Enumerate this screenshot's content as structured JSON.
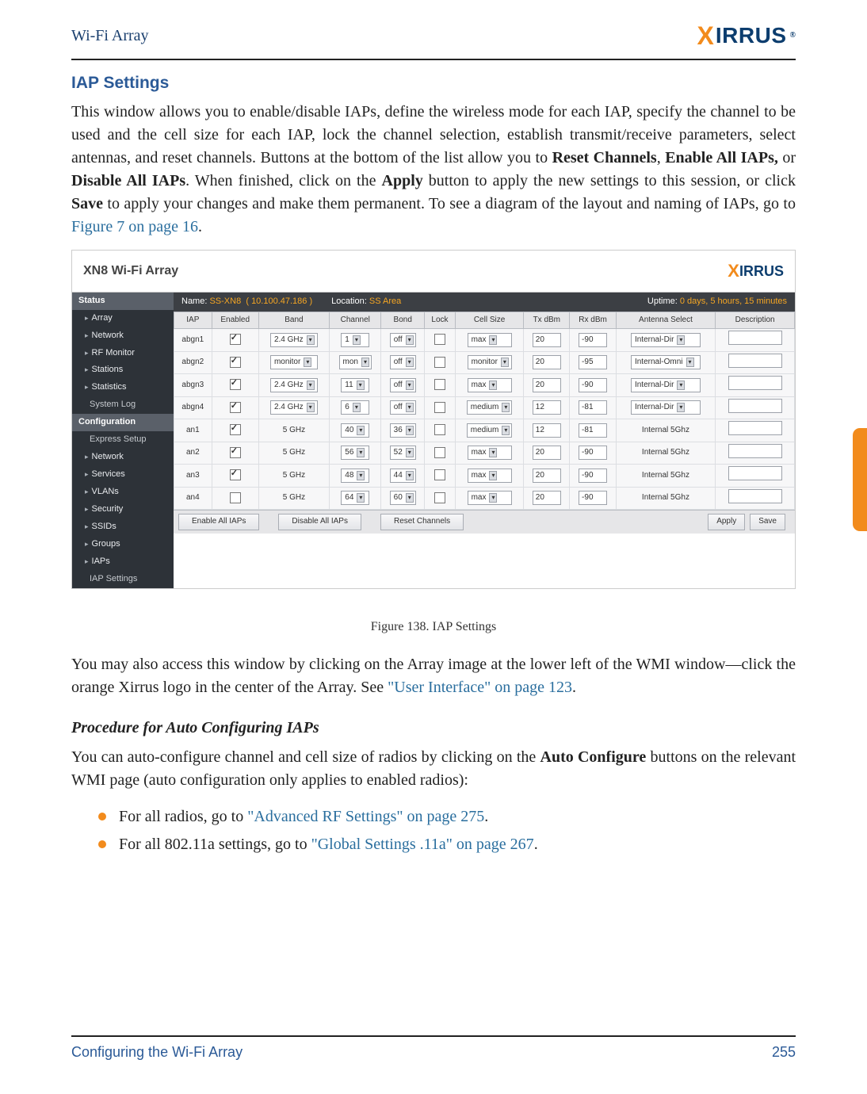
{
  "header": {
    "doc_title": "Wi-Fi Array",
    "logo_prefix": "X",
    "logo_rest": "IRRUS",
    "reg": "®"
  },
  "section_title": "IAP Settings",
  "intro": {
    "p1a": "This window allows you to enable/disable IAPs, define the wireless mode for each IAP, specify the channel to be used and the cell size for each IAP, lock the channel selection, establish transmit/receive parameters, select antennas, and reset channels. Buttons at the bottom of the list allow you to ",
    "b1": "Reset Channels",
    "c1": ", ",
    "b2": "Enable All IAPs,",
    "c2": " or ",
    "b3": "Disable All IAPs",
    "p1b": ". When finished, click on the ",
    "b4": "Apply",
    "p1c": " button to apply the new settings to this session, or click ",
    "b5": "Save",
    "p1d": " to apply your changes and make them permanent. To see a diagram of the layout and naming of IAPs, go to ",
    "link1": "Figure 7 on page 16",
    "p1e": "."
  },
  "screenshot": {
    "titlebar": "XN8 Wi-Fi Array",
    "logo_prefix": "X",
    "logo_rest": "IRRUS",
    "info": {
      "name_lbl": "Name:",
      "name_val": "SS-XN8",
      "ip": "( 10.100.47.186 )",
      "loc_lbl": "Location:",
      "loc_val": "SS Area",
      "up_lbl": "Uptime:",
      "up_val": "0 days, 5 hours, 15 minutes"
    },
    "nav": [
      {
        "label": "Status",
        "cls": "status nobullet"
      },
      {
        "label": "Array"
      },
      {
        "label": "Network"
      },
      {
        "label": "RF Monitor"
      },
      {
        "label": "Stations"
      },
      {
        "label": "Statistics"
      },
      {
        "label": "System Log",
        "cls": "sub nobullet"
      },
      {
        "label": "Configuration",
        "cls": "cfg nobullet"
      },
      {
        "label": "Express Setup",
        "cls": "sub nobullet"
      },
      {
        "label": "Network"
      },
      {
        "label": "Services"
      },
      {
        "label": "VLANs"
      },
      {
        "label": "Security"
      },
      {
        "label": "SSIDs"
      },
      {
        "label": "Groups"
      },
      {
        "label": "IAPs"
      },
      {
        "label": "IAP Settings",
        "cls": "sub nobullet"
      }
    ],
    "cols": [
      "IAP",
      "Enabled",
      "Band",
      "Channel",
      "Bond",
      "Lock",
      "Cell Size",
      "Tx dBm",
      "Rx dBm",
      "Antenna Select",
      "Description"
    ],
    "rows": [
      {
        "iap": "abgn1",
        "en": true,
        "band": "2.4 GHz",
        "band_sel": true,
        "ch": "1",
        "ch_sel": true,
        "bond": "off",
        "lock": false,
        "cell": "max",
        "tx": "20",
        "rx": "-90",
        "ant": "Internal-Dir",
        "ant_sel": true
      },
      {
        "iap": "abgn2",
        "en": true,
        "band": "monitor",
        "band_sel": true,
        "ch": "mon",
        "ch_sel": true,
        "bond": "off",
        "lock": false,
        "cell": "monitor",
        "tx": "20",
        "rx": "-95",
        "ant": "Internal-Omni",
        "ant_sel": true
      },
      {
        "iap": "abgn3",
        "en": true,
        "band": "2.4 GHz",
        "band_sel": true,
        "ch": "11",
        "ch_sel": true,
        "bond": "off",
        "lock": false,
        "cell": "max",
        "tx": "20",
        "rx": "-90",
        "ant": "Internal-Dir",
        "ant_sel": true
      },
      {
        "iap": "abgn4",
        "en": true,
        "band": "2.4 GHz",
        "band_sel": true,
        "ch": "6",
        "ch_sel": true,
        "bond": "off",
        "lock": false,
        "cell": "medium",
        "tx": "12",
        "rx": "-81",
        "ant": "Internal-Dir",
        "ant_sel": true
      },
      {
        "iap": "an1",
        "en": true,
        "band": "5 GHz",
        "band_sel": false,
        "ch": "40",
        "ch_sel": true,
        "bond": "36",
        "lock": false,
        "cell": "medium",
        "tx": "12",
        "rx": "-81",
        "ant": "Internal 5Ghz",
        "ant_sel": false
      },
      {
        "iap": "an2",
        "en": true,
        "band": "5 GHz",
        "band_sel": false,
        "ch": "56",
        "ch_sel": true,
        "bond": "52",
        "lock": false,
        "cell": "max",
        "tx": "20",
        "rx": "-90",
        "ant": "Internal 5Ghz",
        "ant_sel": false
      },
      {
        "iap": "an3",
        "en": true,
        "band": "5 GHz",
        "band_sel": false,
        "ch": "48",
        "ch_sel": true,
        "bond": "44",
        "lock": false,
        "cell": "max",
        "tx": "20",
        "rx": "-90",
        "ant": "Internal 5Ghz",
        "ant_sel": false
      },
      {
        "iap": "an4",
        "en": false,
        "band": "5 GHz",
        "band_sel": false,
        "ch": "64",
        "ch_sel": true,
        "bond": "60",
        "lock": false,
        "cell": "max",
        "tx": "20",
        "rx": "-90",
        "ant": "Internal 5Ghz",
        "ant_sel": false
      }
    ],
    "buttons": {
      "enable": "Enable All IAPs",
      "disable": "Disable All IAPs",
      "reset": "Reset Channels",
      "apply": "Apply",
      "save": "Save"
    }
  },
  "figcap": "Figure 138. IAP Settings",
  "para2": {
    "a": "You may also access this window by clicking on the Array image at the lower left of the WMI window—click the orange Xirrus logo in the center of the Array. See ",
    "link": "\"User Interface\" on page 123",
    "b": "."
  },
  "sub_h": "Procedure for Auto Configuring IAPs",
  "para3": {
    "a": "You can auto-configure channel and cell size of radios by clicking on the ",
    "b": "Auto Configure",
    "c": " buttons on the relevant WMI page (auto configuration only applies to enabled radios):"
  },
  "bullets": [
    {
      "a": "For all radios, go to ",
      "link": "\"Advanced RF Settings\" on page 275",
      "b": "."
    },
    {
      "a": "For all 802.11a settings, go to ",
      "link": "\"Global Settings .11a\" on page 267",
      "b": "."
    }
  ],
  "footer": {
    "left": "Configuring the Wi-Fi Array",
    "right": "255"
  }
}
